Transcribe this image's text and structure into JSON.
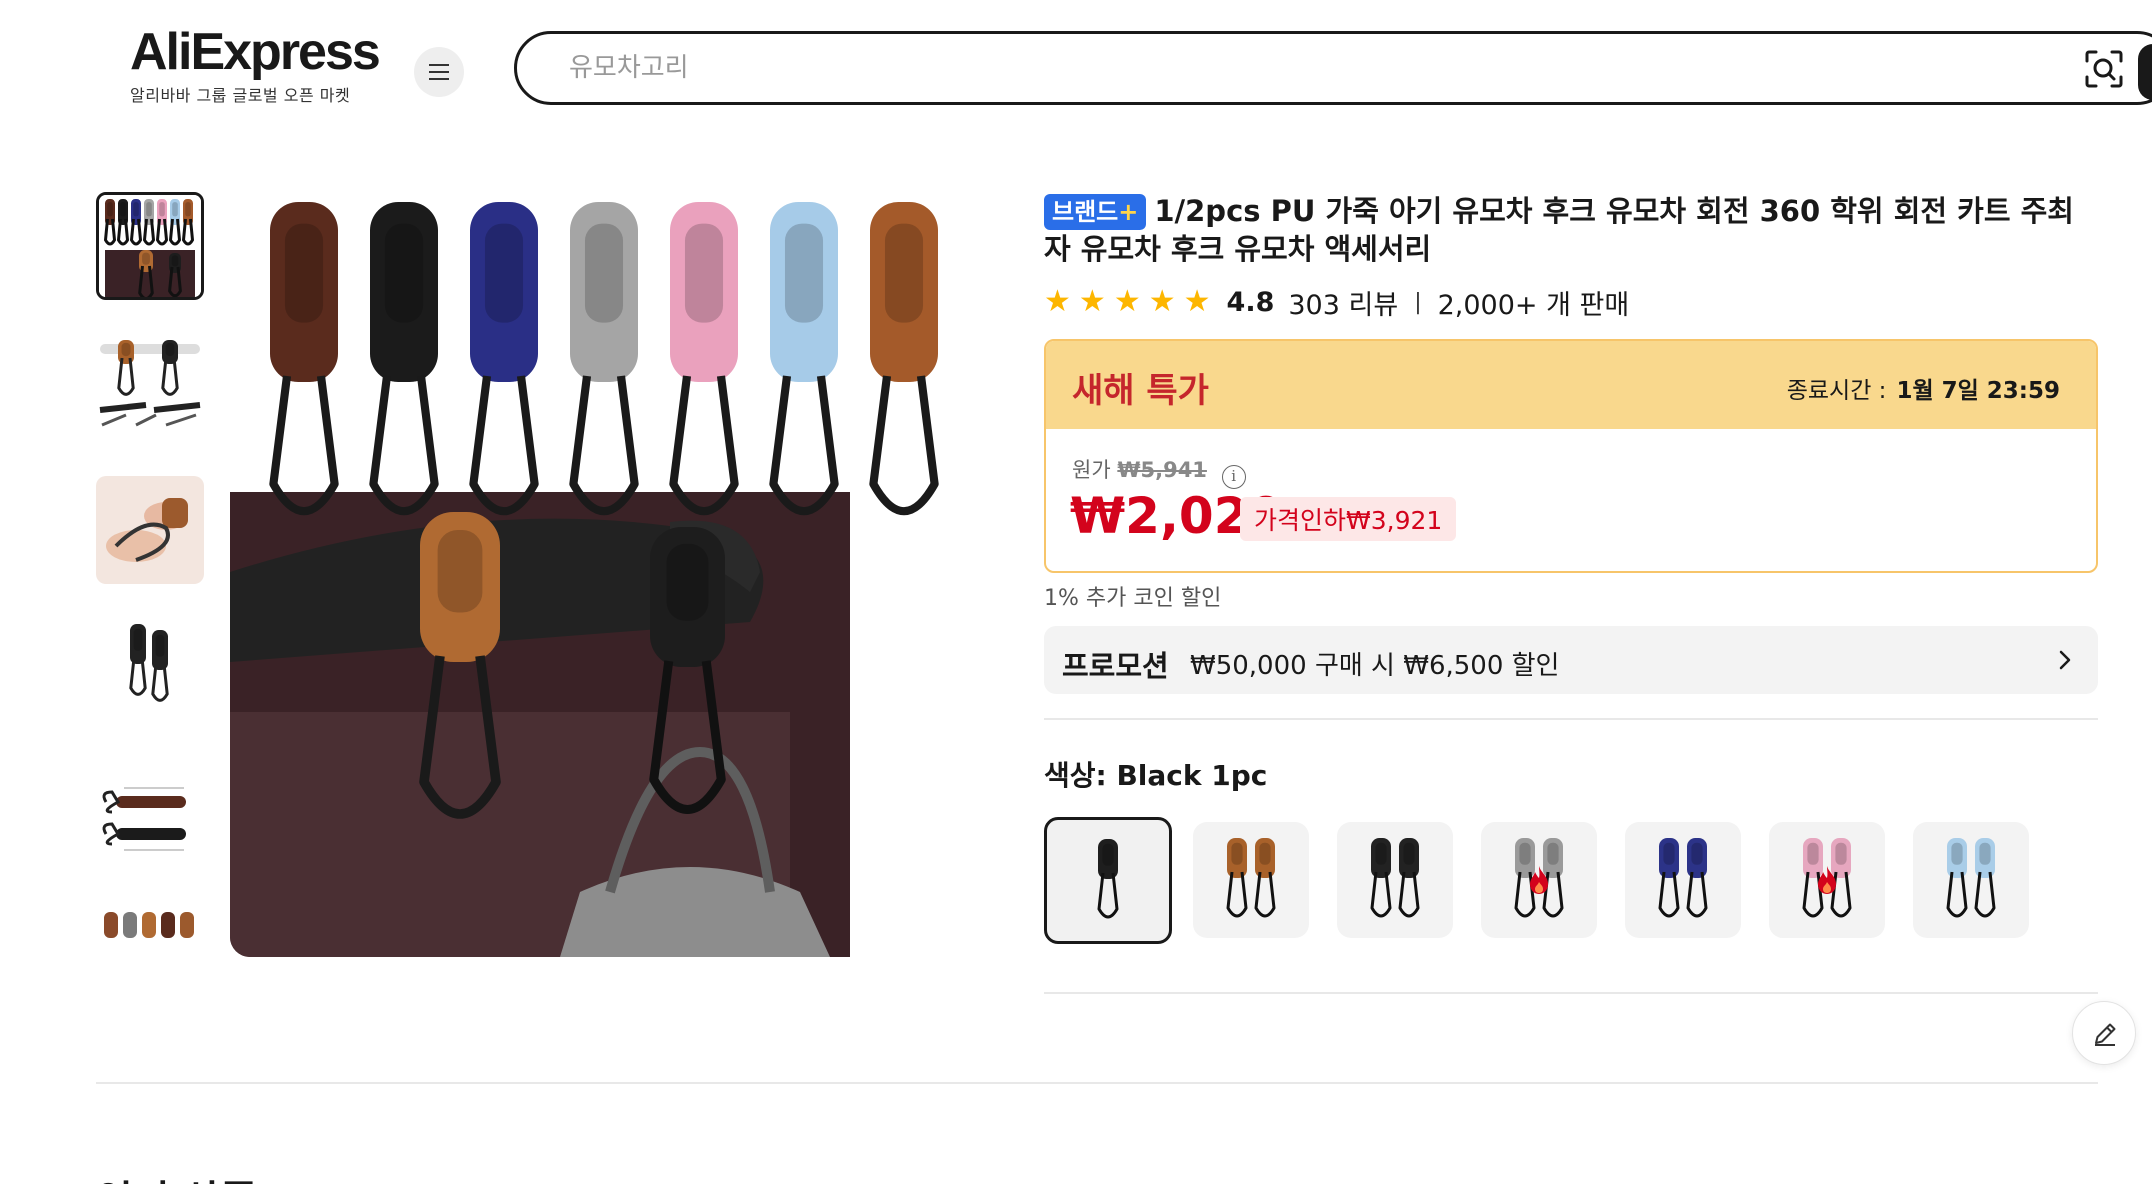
{
  "header": {
    "logo_text": "AliExpress",
    "logo_tagline": "알리바바 그룹 글로벌 오픈 마켓",
    "menu_icon": "hamburger-icon",
    "search_placeholder": "유모차고리",
    "camera_icon": "image-search-icon"
  },
  "gallery": {
    "thumbnails": [
      {
        "name": "thumbnail-all-colors",
        "selected": true
      },
      {
        "name": "thumbnail-hooks-on-bar",
        "selected": false
      },
      {
        "name": "thumbnail-hand-holding",
        "selected": false
      },
      {
        "name": "thumbnail-single-hooks",
        "selected": false
      },
      {
        "name": "thumbnail-dimensions",
        "selected": false
      },
      {
        "name": "thumbnail-colors-row",
        "selected": false
      }
    ]
  },
  "product": {
    "brand_badge": "브랜드",
    "brand_badge_plus": "+",
    "title": "1/2pcs PU 가죽 아기 유모차 후크 유모차 회전 360 학위 회전 카트 주최자 유모차 후크 유모차 액세서리",
    "rating": "4.8",
    "reviews": "303 리뷰",
    "separator": "|",
    "sold": "2,000+ 개 판매"
  },
  "deal": {
    "title": "새해 특가",
    "end_label": "종료시간 :",
    "end_time": "1월 7일 23:59",
    "original_label": "원가",
    "original_price": "₩5,941",
    "price": "₩2,020",
    "discount": "가격인하₩3,921"
  },
  "coin_text": "1% 추가 코인 할인",
  "promo": {
    "label": "프로모션",
    "text": "₩50,000 구매 시 ₩6,500 할인"
  },
  "color": {
    "label": "색상: Black 1pc",
    "swatches": [
      {
        "name": "Black 1pc",
        "color": "#1e1e1e",
        "count": 1,
        "hot": false,
        "selected": true
      },
      {
        "name": "Brown",
        "color": "#a8612a",
        "count": 2,
        "hot": false,
        "selected": false
      },
      {
        "name": "Black",
        "color": "#222222",
        "count": 2,
        "hot": false,
        "selected": false
      },
      {
        "name": "Grey",
        "color": "#9a9a9a",
        "count": 2,
        "hot": true,
        "selected": false
      },
      {
        "name": "Blue",
        "color": "#2c3388",
        "count": 2,
        "hot": false,
        "selected": false
      },
      {
        "name": "Pink",
        "color": "#e6a7bf",
        "count": 2,
        "hot": true,
        "selected": false
      },
      {
        "name": "Light Blue",
        "color": "#a9cde8",
        "count": 2,
        "hot": false,
        "selected": false
      }
    ]
  },
  "hook_colors": [
    "#5a2b1d",
    "#1b1b1b",
    "#2a2f86",
    "#a5a5a5",
    "#eaa1bd",
    "#a6cbe8",
    "#a45a2a"
  ],
  "accent_red": "#d3031c",
  "bottom_heading": "인기 상품"
}
